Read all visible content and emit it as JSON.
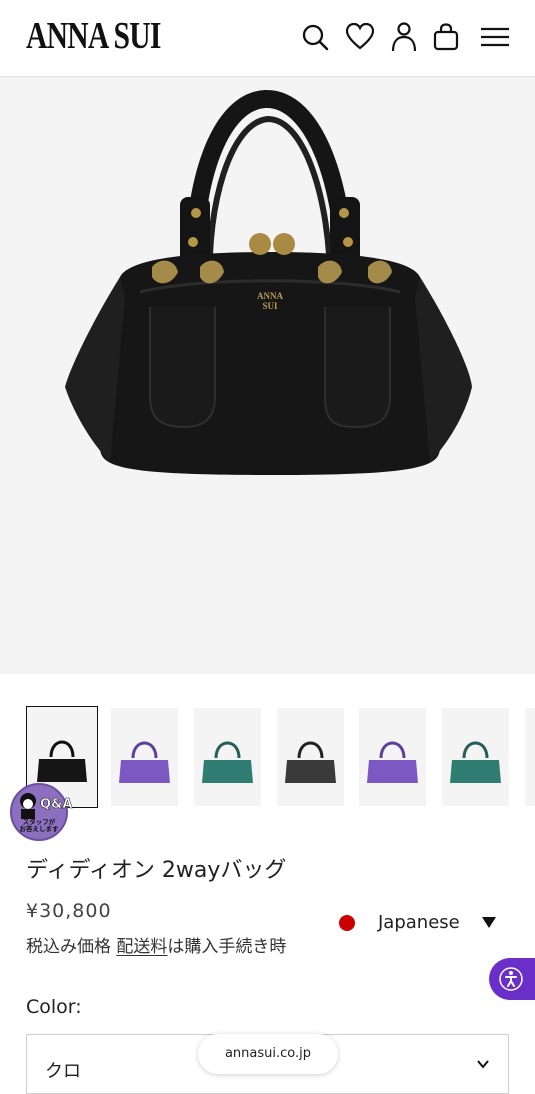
{
  "header": {
    "logo": "ANNA SUI",
    "icons": [
      "search-icon",
      "heart-icon",
      "user-icon",
      "bag-icon",
      "menu-icon"
    ]
  },
  "product": {
    "image_alt": "black handbag",
    "thumbnail_colors": [
      "black",
      "purple",
      "teal",
      "dark-grey",
      "purple",
      "teal"
    ],
    "title": "ディディオン 2wayバッグ",
    "price": "¥30,800",
    "tax_prefix": "税込み価格",
    "shipping_link": "配送料",
    "tax_suffix": "は購入手続き時",
    "color_label": "Color:",
    "color_value": "クロ"
  },
  "qa_badge": {
    "title": "Q&A",
    "subtitle_line1": "スタッフが",
    "subtitle_line2": "お答えします"
  },
  "language": {
    "label": "Japanese"
  },
  "browser": {
    "url": "annasui.co.jp"
  },
  "colors": {
    "accessibility": "#6a2fc9",
    "qa_badge": "#8d6fbf",
    "flag": "#cc0000"
  }
}
